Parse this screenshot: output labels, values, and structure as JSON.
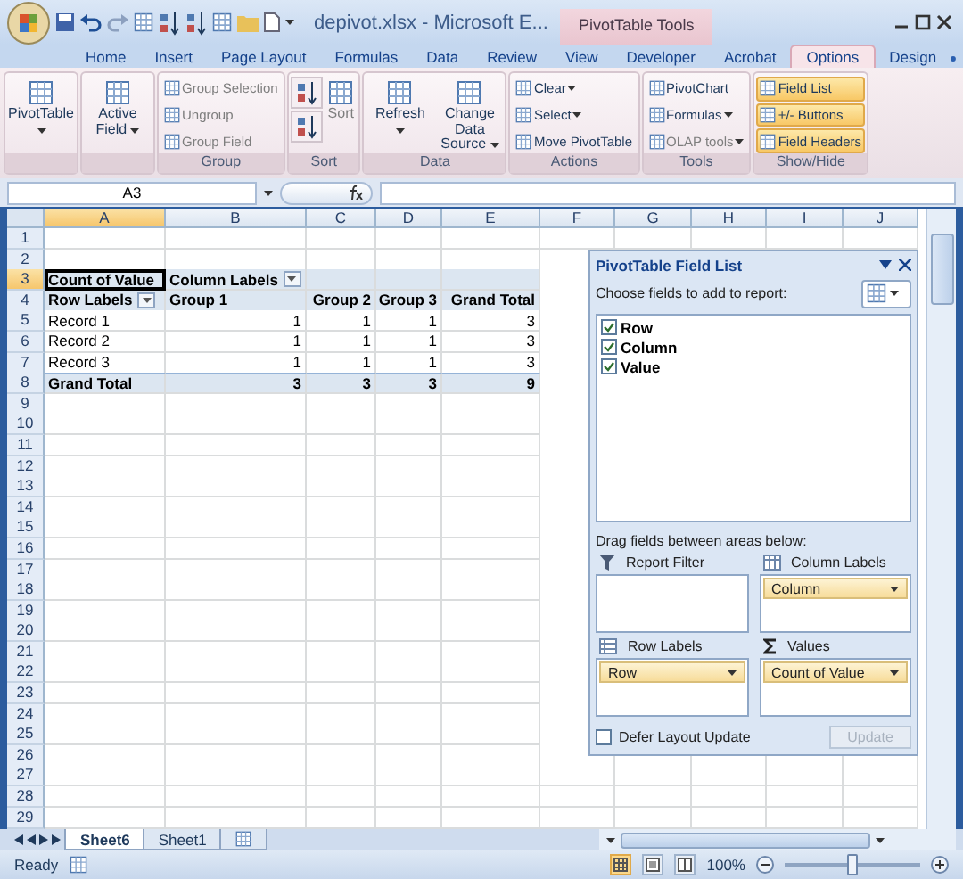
{
  "window": {
    "title": "depivot.xlsx - Microsoft E...",
    "context_tab": "PivotTable Tools"
  },
  "ribbon_tabs": [
    {
      "label": "Home",
      "selected": false
    },
    {
      "label": "Insert",
      "selected": false
    },
    {
      "label": "Page Layout",
      "selected": false
    },
    {
      "label": "Formulas",
      "selected": false
    },
    {
      "label": "Data",
      "selected": false
    },
    {
      "label": "Review",
      "selected": false
    },
    {
      "label": "View",
      "selected": false
    },
    {
      "label": "Developer",
      "selected": false
    },
    {
      "label": "Acrobat",
      "selected": false
    },
    {
      "label": "Options",
      "selected": true
    },
    {
      "label": "Design",
      "selected": false
    }
  ],
  "ribbon_groups": [
    {
      "buttons": [
        {
          "label": "PivotTable",
          "kind": "large",
          "dropdown": true,
          "disabled": false,
          "on": false
        }
      ]
    },
    {
      "buttons": [
        {
          "label": "Active Field",
          "kind": "large",
          "dropdown": true,
          "disabled": false,
          "on": false
        }
      ]
    },
    {
      "label": "Group",
      "buttons": [
        {
          "label": "Group Selection",
          "kind": "small",
          "dropdown": false,
          "disabled": true,
          "on": false
        },
        {
          "label": "Ungroup",
          "kind": "small",
          "dropdown": false,
          "disabled": true,
          "on": false
        },
        {
          "label": "Group Field",
          "kind": "small",
          "dropdown": false,
          "disabled": true,
          "on": false
        }
      ]
    },
    {
      "label": "Sort",
      "buttons": [
        {
          "kind": "sort",
          "dropdown": false,
          "disabled": false,
          "on": false
        },
        {
          "kind": "sort",
          "dropdown": false,
          "disabled": false,
          "on": false
        },
        {
          "label": "Sort",
          "kind": "large",
          "dropdown": false,
          "disabled": true,
          "on": false
        }
      ]
    },
    {
      "label": "Data",
      "buttons": [
        {
          "label": "Refresh",
          "kind": "large",
          "dropdown": true,
          "disabled": false,
          "on": false
        },
        {
          "label": "Change Data Source",
          "kind": "large",
          "dropdown": true,
          "disabled": false,
          "on": false
        }
      ]
    },
    {
      "label": "Actions",
      "buttons": [
        {
          "label": "Clear",
          "kind": "small",
          "dropdown": true,
          "disabled": false,
          "on": false
        },
        {
          "label": "Select",
          "kind": "small",
          "dropdown": true,
          "disabled": false,
          "on": false
        },
        {
          "label": "Move PivotTable",
          "kind": "small",
          "dropdown": false,
          "disabled": false,
          "on": false
        }
      ]
    },
    {
      "label": "Tools",
      "buttons": [
        {
          "label": "PivotChart",
          "kind": "small",
          "dropdown": false,
          "disabled": false,
          "on": false
        },
        {
          "label": "Formulas",
          "kind": "small",
          "dropdown": true,
          "disabled": false,
          "on": false
        },
        {
          "label": "OLAP tools",
          "kind": "small",
          "dropdown": true,
          "disabled": true,
          "on": false
        }
      ]
    },
    {
      "label": "Show/Hide",
      "buttons": [
        {
          "label": "Field List",
          "kind": "small",
          "dropdown": false,
          "disabled": false,
          "on": true
        },
        {
          "label": "+/- Buttons",
          "kind": "small",
          "dropdown": false,
          "disabled": false,
          "on": true
        },
        {
          "label": "Field Headers",
          "kind": "small",
          "dropdown": false,
          "disabled": false,
          "on": true
        }
      ]
    }
  ],
  "formula_bar": {
    "name_box": "A3"
  },
  "columns": [
    {
      "label": "A",
      "selected": true
    },
    {
      "label": "B",
      "selected": false
    },
    {
      "label": "C",
      "selected": false
    },
    {
      "label": "D",
      "selected": false
    },
    {
      "label": "E",
      "selected": false
    },
    {
      "label": "F",
      "selected": false
    },
    {
      "label": "G",
      "selected": false
    },
    {
      "label": "H",
      "selected": false
    },
    {
      "label": "I",
      "selected": false
    },
    {
      "label": "J",
      "selected": false
    }
  ],
  "rows": [
    {
      "number": "1",
      "kind": "blank",
      "selected": false
    },
    {
      "number": "2",
      "kind": "blank",
      "selected": false
    },
    {
      "number": "3",
      "kind": "header",
      "selected": true,
      "cells": [
        {
          "text": "Count of Value",
          "filter": false,
          "selected": true
        },
        {
          "text": "Column Labels",
          "filter": true,
          "selected": false
        }
      ]
    },
    {
      "number": "4",
      "kind": "header",
      "selected": false,
      "cells": [
        {
          "text": "Row Labels",
          "filter": true,
          "selected": false
        },
        {
          "text": "Group 1",
          "filter": false,
          "selected": false
        },
        {
          "text": "Group 2",
          "filter": false,
          "selected": false
        },
        {
          "text": "Group 3",
          "filter": false,
          "selected": false
        },
        {
          "text": "Grand Total",
          "filter": false,
          "selected": false
        }
      ]
    },
    {
      "number": "5",
      "kind": "data",
      "selected": false,
      "cells": [
        {
          "text": "Record 1",
          "filter": false,
          "selected": false
        },
        {
          "text": "1",
          "filter": false,
          "selected": false
        },
        {
          "text": "1",
          "filter": false,
          "selected": false
        },
        {
          "text": "1",
          "filter": false,
          "selected": false
        },
        {
          "text": "3",
          "filter": false,
          "selected": false
        }
      ]
    },
    {
      "number": "6",
      "kind": "data",
      "selected": false,
      "cells": [
        {
          "text": "Record 2",
          "filter": false,
          "selected": false
        },
        {
          "text": "1",
          "filter": false,
          "selected": false
        },
        {
          "text": "1",
          "filter": false,
          "selected": false
        },
        {
          "text": "1",
          "filter": false,
          "selected": false
        },
        {
          "text": "3",
          "filter": false,
          "selected": false
        }
      ]
    },
    {
      "number": "7",
      "kind": "data",
      "selected": false,
      "cells": [
        {
          "text": "Record 3",
          "filter": false,
          "selected": false
        },
        {
          "text": "1",
          "filter": false,
          "selected": false
        },
        {
          "text": "1",
          "filter": false,
          "selected": false
        },
        {
          "text": "1",
          "filter": false,
          "selected": false
        },
        {
          "text": "3",
          "filter": false,
          "selected": false
        }
      ]
    },
    {
      "number": "8",
      "kind": "total",
      "selected": false,
      "cells": [
        {
          "text": "Grand Total",
          "filter": false,
          "selected": false
        },
        {
          "text": "3",
          "filter": false,
          "selected": false
        },
        {
          "text": "3",
          "filter": false,
          "selected": false
        },
        {
          "text": "3",
          "filter": false,
          "selected": false
        },
        {
          "text": "9",
          "filter": false,
          "selected": false
        }
      ]
    },
    {
      "number": "9",
      "kind": "blank",
      "selected": false
    },
    {
      "number": "10",
      "kind": "blank",
      "selected": false
    },
    {
      "number": "11",
      "kind": "blank",
      "selected": false
    },
    {
      "number": "12",
      "kind": "blank",
      "selected": false
    },
    {
      "number": "13",
      "kind": "blank",
      "selected": false
    },
    {
      "number": "14",
      "kind": "blank",
      "selected": false
    },
    {
      "number": "15",
      "kind": "blank",
      "selected": false
    },
    {
      "number": "16",
      "kind": "blank",
      "selected": false
    },
    {
      "number": "17",
      "kind": "blank",
      "selected": false
    },
    {
      "number": "18",
      "kind": "blank",
      "selected": false
    },
    {
      "number": "19",
      "kind": "blank",
      "selected": false
    },
    {
      "number": "20",
      "kind": "blank",
      "selected": false
    },
    {
      "number": "21",
      "kind": "blank",
      "selected": false
    },
    {
      "number": "22",
      "kind": "blank",
      "selected": false
    },
    {
      "number": "23",
      "kind": "blank",
      "selected": false
    },
    {
      "number": "24",
      "kind": "blank",
      "selected": false
    },
    {
      "number": "25",
      "kind": "blank",
      "selected": false
    },
    {
      "number": "26",
      "kind": "blank",
      "selected": false
    },
    {
      "number": "27",
      "kind": "blank",
      "selected": false
    },
    {
      "number": "28",
      "kind": "blank",
      "selected": false
    },
    {
      "number": "29",
      "kind": "blank",
      "selected": false
    }
  ],
  "pivot_panel": {
    "title": "PivotTable Field List",
    "prompt": "Choose fields to add to report:",
    "fields": [
      {
        "label": "Row",
        "checked": true
      },
      {
        "label": "Column",
        "checked": true
      },
      {
        "label": "Value",
        "checked": true
      }
    ],
    "drag_prompt": "Drag fields between areas below:",
    "areas": [
      {
        "kind": "filter",
        "label": "Report Filter"
      },
      {
        "kind": "columns",
        "label": "Column Labels",
        "items": [
          "Column"
        ]
      },
      {
        "kind": "rows",
        "label": "Row Labels",
        "items": [
          "Row"
        ]
      },
      {
        "kind": "values",
        "label": "Values",
        "items": [
          "Count of Value"
        ]
      }
    ],
    "defer": {
      "label": "Defer Layout Update",
      "checked": false
    },
    "update_button": {
      "label": "Update",
      "disabled": true
    }
  },
  "sheet_tabs": [
    {
      "label": "Sheet6",
      "selected": true
    },
    {
      "label": "Sheet1",
      "selected": false
    }
  ],
  "status_bar": {
    "text": "Ready",
    "view_buttons": [
      {
        "kind": "normal",
        "selected": true
      },
      {
        "kind": "page-layout",
        "selected": false
      },
      {
        "kind": "page-break",
        "selected": false
      }
    ],
    "zoom": "100%",
    "zoom_slider": {
      "level": 0.5
    }
  }
}
